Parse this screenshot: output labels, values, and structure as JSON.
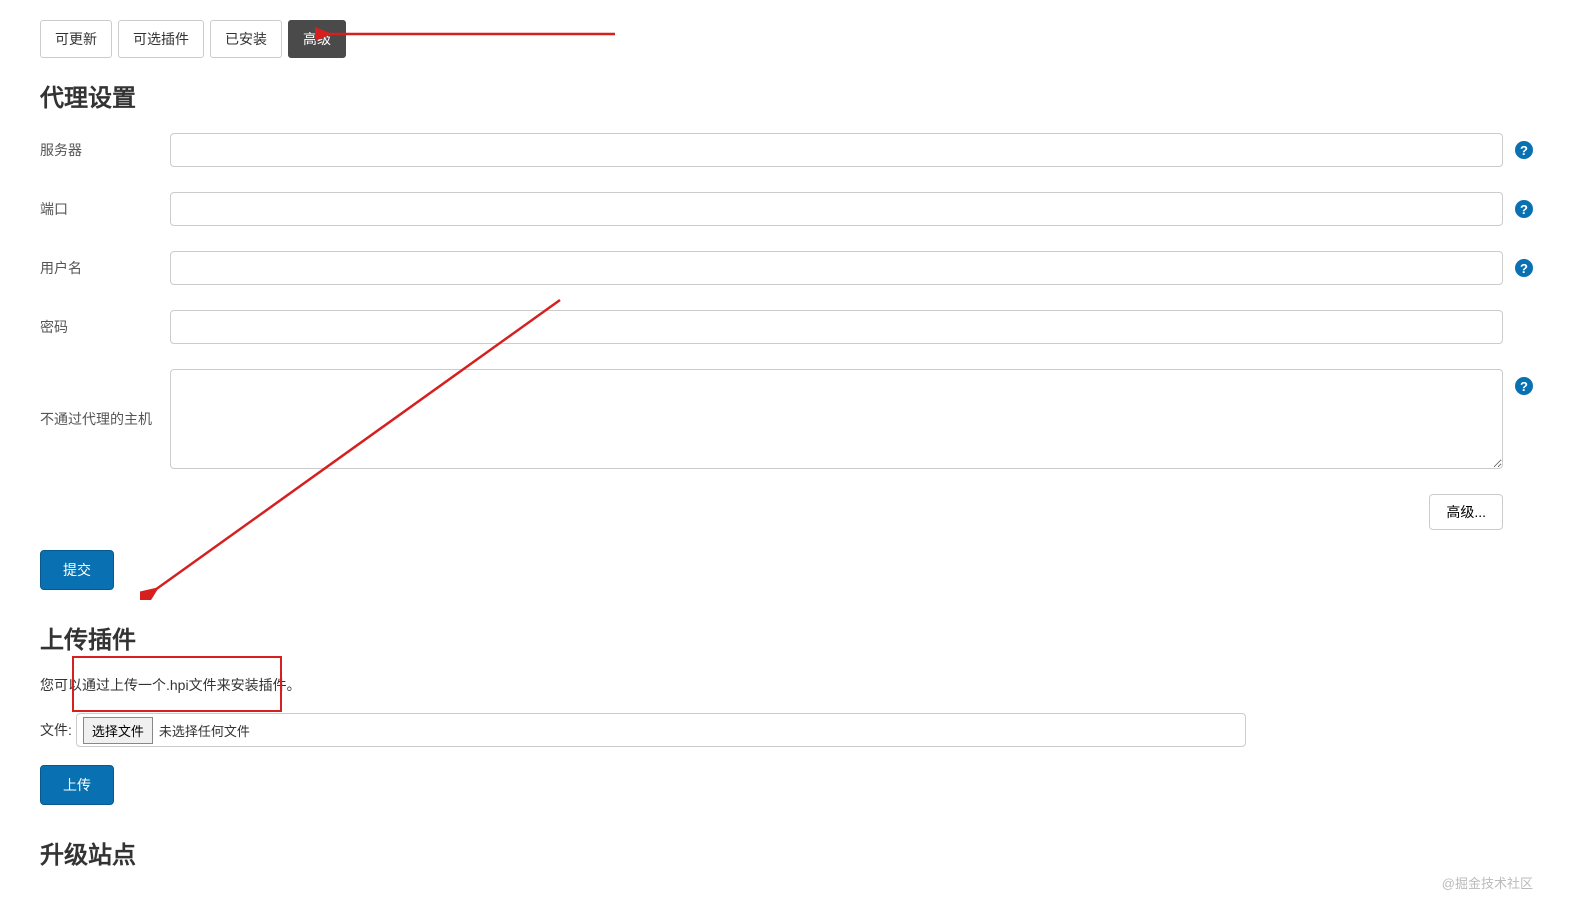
{
  "tabs": {
    "updatable": "可更新",
    "available": "可选插件",
    "installed": "已安装",
    "advanced": "高级"
  },
  "sections": {
    "proxy_title": "代理设置",
    "upload_title": "上传插件",
    "upgrade_title": "升级站点"
  },
  "proxy_form": {
    "server_label": "服务器",
    "server_value": "",
    "port_label": "端口",
    "port_value": "",
    "username_label": "用户名",
    "username_value": "",
    "password_label": "密码",
    "password_value": "",
    "noproxy_label": "不通过代理的主机",
    "noproxy_value": "",
    "advanced_button": "高级...",
    "submit_button": "提交"
  },
  "upload": {
    "description": "您可以通过上传一个.hpi文件来安装插件。",
    "file_label": "文件:",
    "choose_button": "选择文件",
    "no_file_text": "未选择任何文件",
    "upload_button": "上传"
  },
  "help_icon": "?",
  "watermark": "@掘金技术社区"
}
